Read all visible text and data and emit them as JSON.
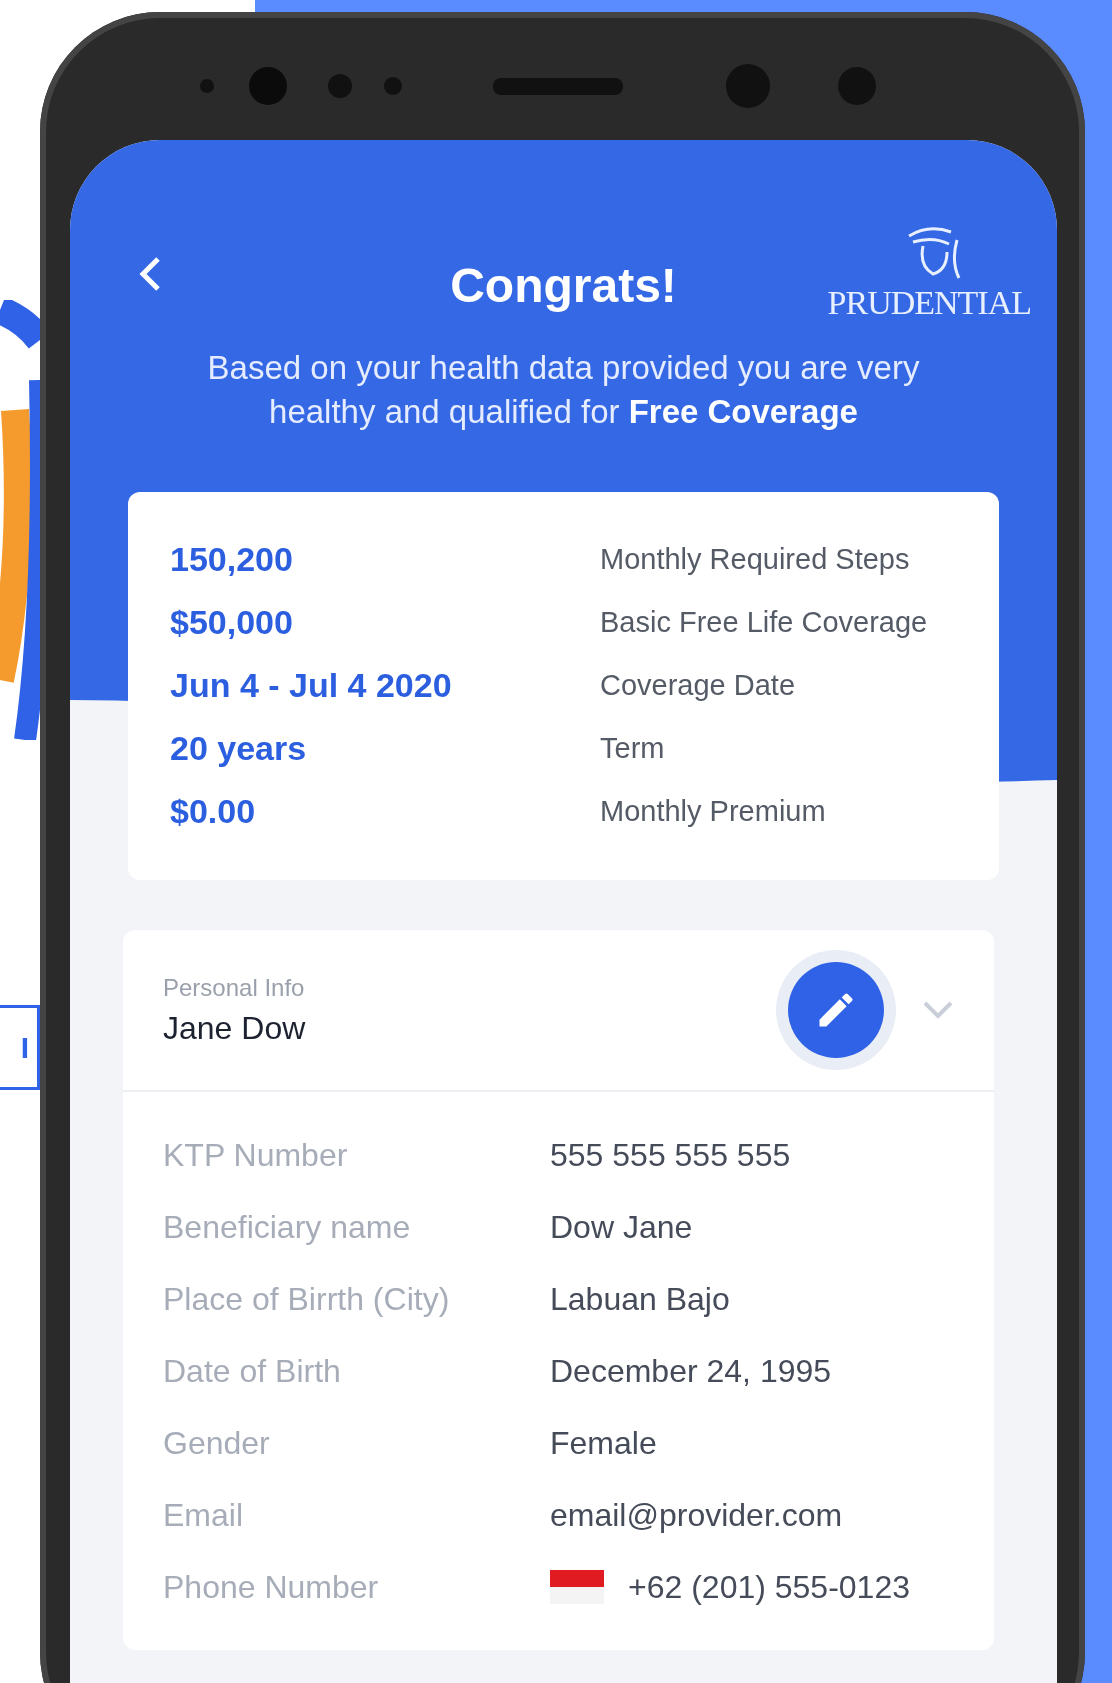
{
  "background_button": {
    "label": "I"
  },
  "header": {
    "title": "Congrats!",
    "logo_text": "PRUDENTIAL",
    "subtitle": "Based on your health data provided you are very healthy and qualified for **Free Coverage**"
  },
  "summary": [
    {
      "value": "150,200",
      "label": "Monthly Required Steps"
    },
    {
      "value": "$50,000",
      "label": "Basic Free Life Coverage"
    },
    {
      "value": "Jun 4 - Jul 4 2020",
      "label": "Coverage Date"
    },
    {
      "value": "20 years",
      "label": "Term"
    },
    {
      "value": "$0.00",
      "label": "Monthly Premium"
    }
  ],
  "personal_info": {
    "section_label": "Personal Info",
    "name": "Jane Dow",
    "fields": [
      {
        "kind": "text",
        "label": "KTP Number",
        "value": "555 555 555 555"
      },
      {
        "kind": "text",
        "label": "Beneficiary name",
        "value": "Dow Jane"
      },
      {
        "kind": "text",
        "label": "Place of Birrth (City)",
        "value": "Labuan Bajo"
      },
      {
        "kind": "text",
        "label": "Date of Birth",
        "value": "December 24, 1995"
      },
      {
        "kind": "text",
        "label": "Gender",
        "value": "Female"
      },
      {
        "kind": "text",
        "label": "Email",
        "value": "email@provider.com"
      },
      {
        "kind": "phone",
        "label": "Phone Number",
        "value": "+62 (201) 555-0123"
      }
    ]
  }
}
